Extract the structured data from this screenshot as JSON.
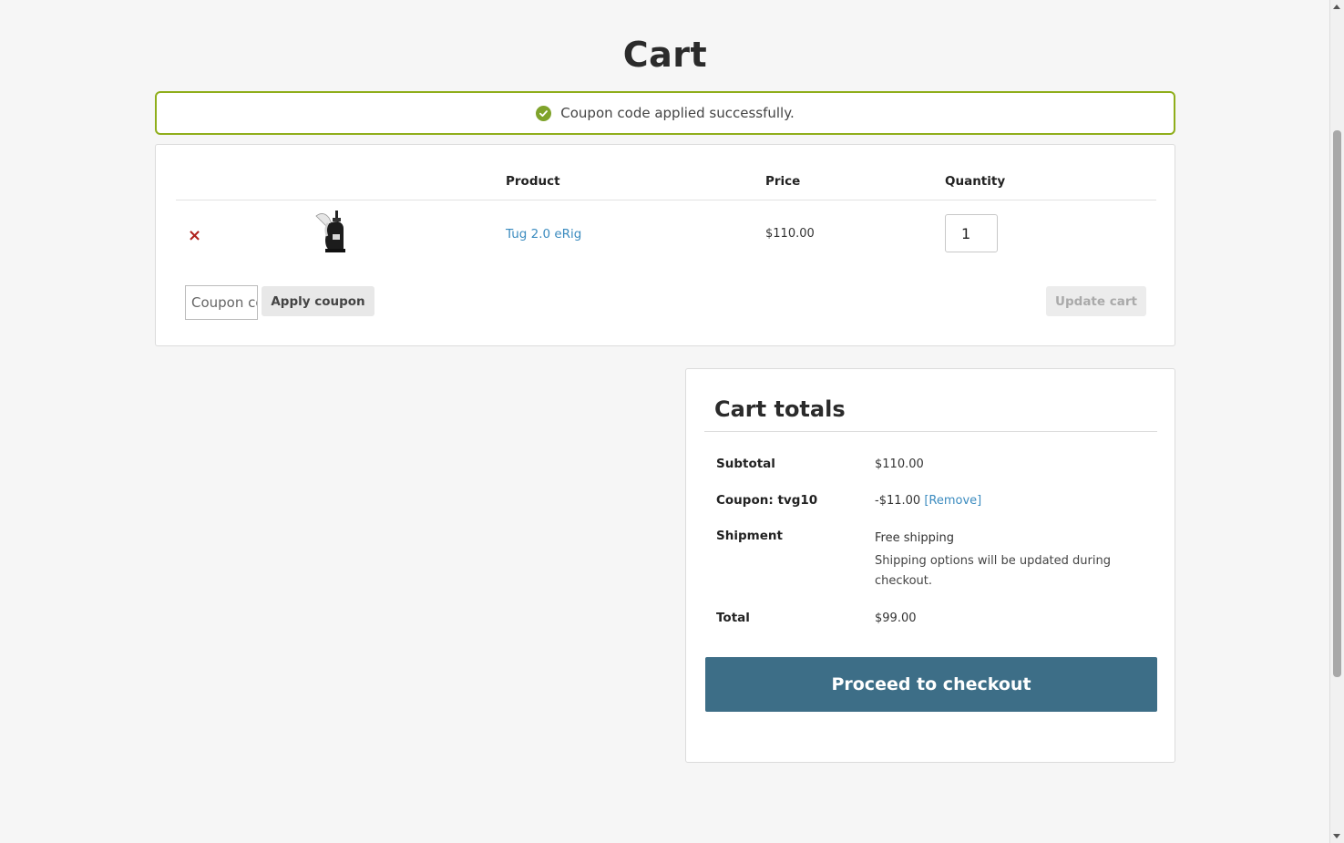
{
  "page": {
    "title": "Cart"
  },
  "notice": {
    "text": "Coupon code applied successfully."
  },
  "cart": {
    "headers": {
      "product": "Product",
      "price": "Price",
      "quantity": "Quantity"
    },
    "items": [
      {
        "remove": "×",
        "name": "Tug 2.0 eRig",
        "price": "$110.00",
        "quantity": "1"
      }
    ],
    "coupon_placeholder": "Coupon code",
    "apply_label": "Apply coupon",
    "update_label": "Update cart"
  },
  "totals": {
    "title": "Cart totals",
    "subtotal_label": "Subtotal",
    "subtotal_value": "$110.00",
    "coupon_label": "Coupon: tvg10",
    "coupon_value": "-$11.00",
    "coupon_remove": "[Remove]",
    "shipment_label": "Shipment",
    "shipment_value": "Free shipping",
    "shipment_note": "Shipping options will be updated during checkout.",
    "total_label": "Total",
    "total_value": "$99.00",
    "checkout_label": "Proceed to checkout"
  },
  "colors": {
    "accent": "#3d6e87",
    "success": "#8fae1b",
    "link": "#3b8bbf",
    "remove": "#b0211c"
  }
}
